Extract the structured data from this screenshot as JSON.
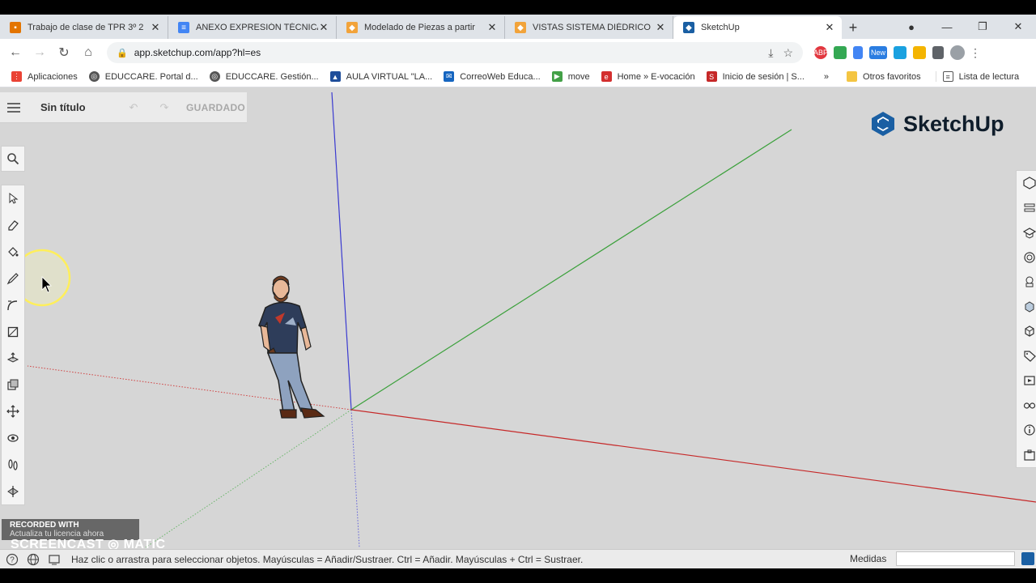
{
  "browser": {
    "tabs": [
      {
        "title": "Trabajo de clase de TPR 3º 2",
        "icon": "classroom-icon",
        "color": "#e37400"
      },
      {
        "title": "ANEXO EXPRESIÓN TÉCNICA",
        "icon": "docs-icon",
        "color": "#4285f4"
      },
      {
        "title": "Modelado de Piezas a partir",
        "icon": "sketchup-icon",
        "color": "#f2a33a"
      },
      {
        "title": "VISTAS SISTEMA DIÉDRICO",
        "icon": "sketchup-icon",
        "color": "#f2a33a"
      },
      {
        "title": "SketchUp",
        "icon": "sketchup-icon",
        "color": "#1a5fa3",
        "active": true
      }
    ],
    "new_tab": "+",
    "url": "app.sketchup.com/app?hl=es",
    "extensions": [
      {
        "label": "ABP",
        "color": "#e2373f"
      },
      {
        "label": "",
        "color": "#34a853"
      },
      {
        "label": "",
        "color": "#4285f4"
      },
      {
        "label": "New",
        "color": "#2a7de1"
      },
      {
        "label": "",
        "color": "#1aa1e0"
      },
      {
        "label": "",
        "color": "#f4b400"
      },
      {
        "label": "",
        "color": "#5f6368"
      }
    ],
    "bookmarks": [
      {
        "label": "Aplicaciones",
        "icon": "apps-grid-icon",
        "color": "#ea4335"
      },
      {
        "label": "EDUCCARE. Portal d...",
        "icon": "globe-icon",
        "color": "#555555"
      },
      {
        "label": "EDUCCARE. Gestión...",
        "icon": "globe-icon",
        "color": "#555555"
      },
      {
        "label": "AULA VIRTUAL \"LA...",
        "icon": "graduation-cap-icon",
        "color": "#1f4e9a"
      },
      {
        "label": "CorreoWeb Educa...",
        "icon": "mail-icon",
        "color": "#1565c0"
      },
      {
        "label": "move",
        "icon": "play-icon",
        "color": "#43a047"
      },
      {
        "label": "Home » E-vocación",
        "icon": "evocacion-icon",
        "color": "#d32f2f"
      },
      {
        "label": "Inicio de sesión | S...",
        "icon": "sm-logo-icon",
        "color": "#c62828"
      }
    ],
    "bookmarks_more": "»",
    "other_favorites": "Otros favoritos",
    "reading_list": "Lista de lectura"
  },
  "app": {
    "doc_title": "Sin título",
    "saved_label": "GUARDADO",
    "brand": "SketchUp",
    "left_tools": [
      "select-icon",
      "eraser-icon",
      "paint-bucket-icon",
      "pencil-icon",
      "arc-icon",
      "rectangle-icon",
      "push-pull-icon",
      "offset-icon",
      "move-icon",
      "orbit-icon",
      "footprints-icon",
      "section-plane-icon"
    ],
    "right_tools": [
      "entity-info-icon",
      "instructor-icon",
      "components-icon",
      "materials-icon",
      "styles-icon",
      "layers-icon",
      "outliner-icon",
      "scenes-icon",
      "tags-icon",
      "display-icon",
      "glasses-icon",
      "info-icon",
      "sun-icon"
    ],
    "status_text": "Haz clic o arrastra para seleccionar objetos. Mayúsculas = Añadir/Sustraer. Ctrl = Añadir. Mayúsculas + Ctrl = Sustraer.",
    "measure_label": "Medidas"
  },
  "watermark": {
    "line1": "RECORDED WITH",
    "line2": "Actualiza tu licencia ahora",
    "line3": "SCREENCAST ◎ MATIC"
  }
}
